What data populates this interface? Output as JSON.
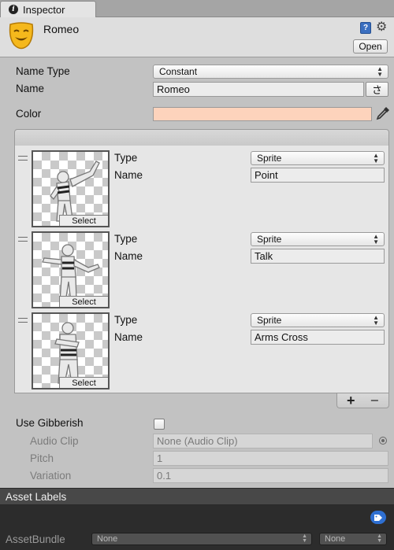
{
  "window": {
    "tab_title": "Inspector"
  },
  "header": {
    "object_name": "Romeo",
    "open_label": "Open",
    "icons": [
      "theatre-mask-icon",
      "help-book-icon",
      "gear-icon",
      "info-icon"
    ]
  },
  "properties": {
    "name_type_label": "Name Type",
    "name_type_value": "Constant",
    "name_label": "Name",
    "name_value": "Romeo",
    "kana_button": "さ",
    "color_label": "Color",
    "color_value": "#fdd3bc"
  },
  "sprites": [
    {
      "type_label": "Type",
      "type_value": "Sprite",
      "name_label": "Name",
      "name_value": "Point",
      "select_label": "Select"
    },
    {
      "type_label": "Type",
      "type_value": "Sprite",
      "name_label": "Name",
      "name_value": "Talk",
      "select_label": "Select"
    },
    {
      "type_label": "Type",
      "type_value": "Sprite",
      "name_label": "Name",
      "name_value": "Arms Cross",
      "select_label": "Select"
    }
  ],
  "list_footer": {
    "add": "+",
    "remove": "−"
  },
  "gibberish": {
    "use_label": "Use Gibberish",
    "checked": false,
    "audio_clip_label": "Audio Clip",
    "audio_clip_value": "None (Audio Clip)",
    "pitch_label": "Pitch",
    "pitch_value": "1",
    "variation_label": "Variation",
    "variation_value": "0.1"
  },
  "asset_labels": {
    "title": "Asset Labels",
    "assetbundle_label": "AssetBundle",
    "bundle_value": "None",
    "variant_value": "None"
  },
  "colors": {
    "accent": "#2e6fd1",
    "header_bg": "#dedede",
    "body_bg": "#c2c2c2",
    "dark_bg": "#2c2c2c"
  }
}
